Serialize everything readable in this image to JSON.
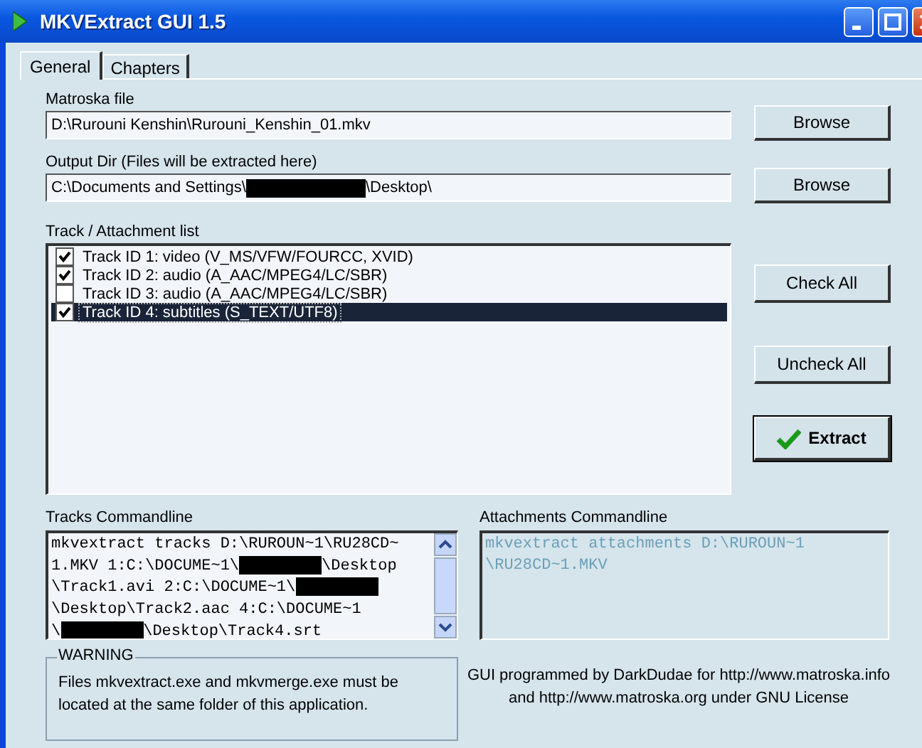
{
  "window": {
    "title": "MKVExtract GUI 1.5"
  },
  "tabs": [
    {
      "label": "General",
      "selected": true
    },
    {
      "label": "Chapters",
      "selected": false
    }
  ],
  "matroska_file": {
    "label": "Matroska file",
    "value": [
      {
        "kind": "text",
        "text": "D:\\Rurouni Kenshin\\Rurouni_Kenshin_01.mkv"
      }
    ],
    "button": "Browse"
  },
  "output_dir": {
    "label": "Output Dir (Files will be extracted here)",
    "value": [
      {
        "kind": "text",
        "text": "C:\\Documents and Settings\\"
      },
      {
        "kind": "redacted"
      },
      {
        "kind": "text",
        "text": "\\Desktop\\"
      }
    ],
    "button": "Browse"
  },
  "track_list": {
    "label": "Track / Attachment list",
    "items": [
      {
        "label": "Track ID 1: video (V_MS/VFW/FOURCC, XVID)",
        "checked": true,
        "selected": false
      },
      {
        "label": "Track ID 2: audio (A_AAC/MPEG4/LC/SBR)",
        "checked": true,
        "selected": false
      },
      {
        "label": "Track ID 3: audio (A_AAC/MPEG4/LC/SBR)",
        "checked": false,
        "selected": false
      },
      {
        "label": "Track ID 4: subtitles (S_TEXT/UTF8)",
        "checked": true,
        "selected": true
      }
    ]
  },
  "buttons": [
    {
      "label": "Check All",
      "kind": "plain"
    },
    {
      "label": "Uncheck All",
      "kind": "plain"
    },
    {
      "label": "Extract",
      "kind": "default"
    }
  ],
  "tracks_commandline": {
    "label": "Tracks Commandline",
    "lines": [
      [
        {
          "kind": "text",
          "text": "mkvextract tracks D:\\RUROUN~1\\RU28CD~"
        }
      ],
      [
        {
          "kind": "text",
          "text": "1.MKV 1:C:\\DOCUME~1\\"
        },
        {
          "kind": "redacted"
        },
        {
          "kind": "text",
          "text": "\\Desktop"
        }
      ],
      [
        {
          "kind": "text",
          "text": "\\Track1.avi 2:C:\\DOCUME~1\\"
        },
        {
          "kind": "redacted"
        }
      ],
      [
        {
          "kind": "text",
          "text": "\\Desktop\\Track2.aac 4:C:\\DOCUME~1"
        }
      ],
      [
        {
          "kind": "text",
          "text": "\\"
        },
        {
          "kind": "redacted"
        },
        {
          "kind": "text",
          "text": "\\Desktop\\Track4.srt"
        }
      ]
    ]
  },
  "attachments_commandline": {
    "label": "Attachments Commandline",
    "lines": [
      "mkvextract attachments D:\\RUROUN~1",
      "\\RU28CD~1.MKV"
    ],
    "disabled": true
  },
  "warning": {
    "title": "WARNING",
    "text": "Files mkvextract.exe and mkvmerge.exe must be located at the same folder of this application."
  },
  "credits": [
    "GUI programmed by DarkDudae for http://www.matroska.info",
    "and http://www.matroska.org under GNU License"
  ]
}
